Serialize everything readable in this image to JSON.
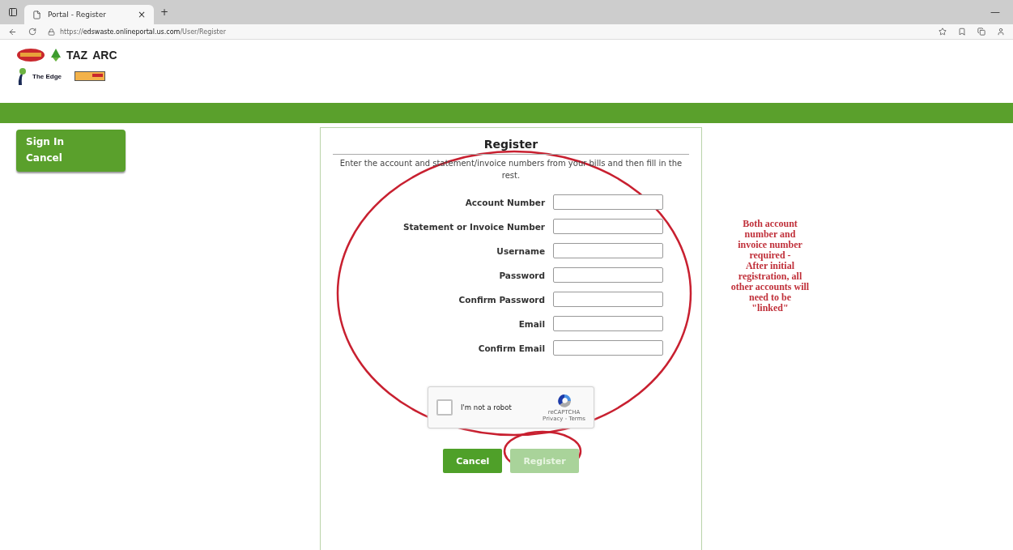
{
  "browser": {
    "tab": {
      "title": "Portal - Register",
      "close": "×"
    },
    "new_tab": "+",
    "minimize": "—",
    "url": {
      "scheme": "https://",
      "host": "edswaste.onlineportal.us.com",
      "path": "/User/Register"
    }
  },
  "logos": [
    {
      "text": "TAZ"
    },
    {
      "text": "ARC"
    },
    {
      "text": "The Edge"
    }
  ],
  "sidebar": {
    "items": [
      "Sign In",
      "Cancel"
    ]
  },
  "form": {
    "title": "Register",
    "intro": "Enter the account and statement/invoice numbers from your bills and then fill in the rest.",
    "fields": [
      {
        "label": "Account Number"
      },
      {
        "label": "Statement or Invoice Number"
      },
      {
        "label": "Username"
      },
      {
        "label": "Password"
      },
      {
        "label": "Confirm Password"
      },
      {
        "label": "Email"
      },
      {
        "label": "Confirm Email"
      }
    ],
    "captcha": {
      "label": "I'm not a robot",
      "checked": false,
      "brand": "reCAPTCHA",
      "links": "Privacy - Terms"
    },
    "buttons": [
      {
        "label": "Cancel",
        "disabled": false
      },
      {
        "label": "Register",
        "disabled": true
      }
    ]
  },
  "annotation": {
    "lines": [
      "Both account",
      "number and",
      "invoice number",
      "required -",
      "After initial",
      "registration, all",
      "other accounts will",
      "need to be",
      "\"linked\""
    ]
  }
}
